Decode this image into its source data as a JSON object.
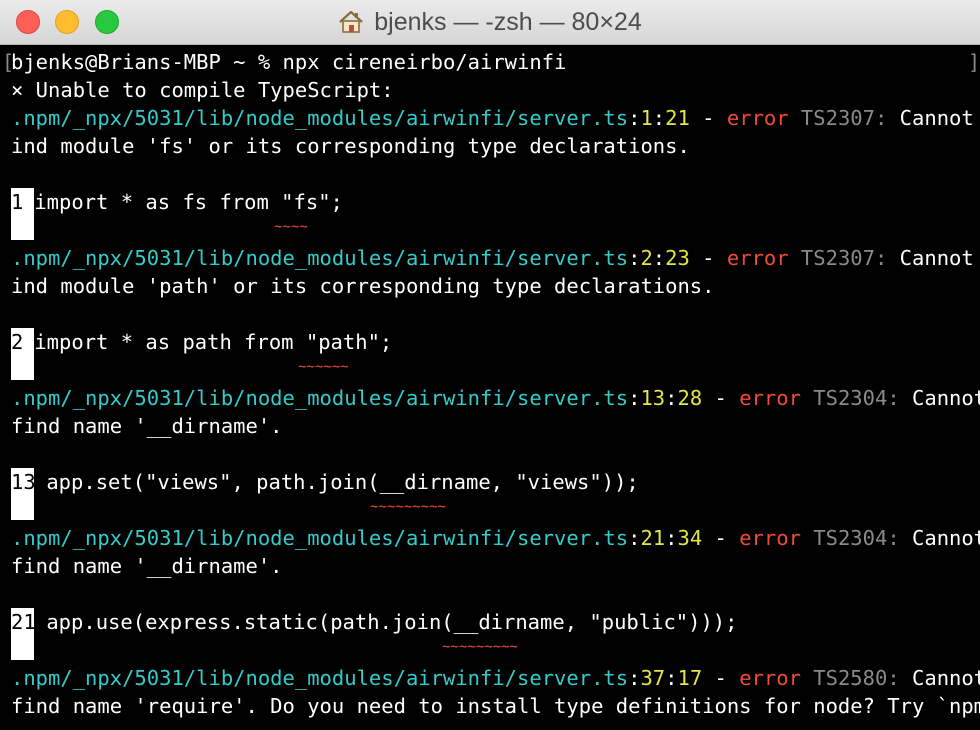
{
  "window": {
    "title": "bjenks — -zsh — 80×24",
    "title_icon": "home-icon",
    "traffic_lights": {
      "close": "#fe5f57",
      "minimize": "#febc2e",
      "maximize": "#28c840"
    }
  },
  "terminal": {
    "prompt": "bjenks@Brians-MBP ~ % npx cireneirbo/airwinfi",
    "unable": "× Unable to compile TypeScript:",
    "errors": [
      {
        "path": ".npm/_npx/5031/lib/node_modules/airwinfi/server.ts",
        "line": "1",
        "col": "21",
        "sep": " - ",
        "level": "error",
        "code": "TS2307:",
        "msg1": " Cannot f",
        "msg2": "ind module 'fs' or its corresponding type declarations.",
        "lineno": "1",
        "code_line": " import * as fs from \"fs\";",
        "squiggle": "~~~~"
      },
      {
        "path": ".npm/_npx/5031/lib/node_modules/airwinfi/server.ts",
        "line": "2",
        "col": "23",
        "sep": " - ",
        "level": "error",
        "code": "TS2307:",
        "msg1": " Cannot f",
        "msg2": "ind module 'path' or its corresponding type declarations.",
        "lineno": "2",
        "code_line": " import * as path from \"path\";",
        "squiggle": "~~~~~~"
      },
      {
        "path": ".npm/_npx/5031/lib/node_modules/airwinfi/server.ts",
        "line": "13",
        "col": "28",
        "sep": " - ",
        "level": "error",
        "code": "TS2304:",
        "msg1": " Cannot",
        "msg2": "find name '__dirname'.",
        "lineno": "13",
        "code_line": " app.set(\"views\", path.join(__dirname, \"views\"));",
        "squiggle": "~~~~~~~~~"
      },
      {
        "path": ".npm/_npx/5031/lib/node_modules/airwinfi/server.ts",
        "line": "21",
        "col": "34",
        "sep": " - ",
        "level": "error",
        "code": "TS2304:",
        "msg1": " Cannot",
        "msg2": "find name '__dirname'.",
        "lineno": "21",
        "code_line": " app.use(express.static(path.join(__dirname, \"public\")));",
        "squiggle": "~~~~~~~~~"
      },
      {
        "path": ".npm/_npx/5031/lib/node_modules/airwinfi/server.ts",
        "line": "37",
        "col": "17",
        "sep": " - ",
        "level": "error",
        "code": "TS2580:",
        "msg1": " Cannot",
        "msg2": "find name 'require'. Do you need to install type definitions for node? Try `npm"
      }
    ]
  }
}
